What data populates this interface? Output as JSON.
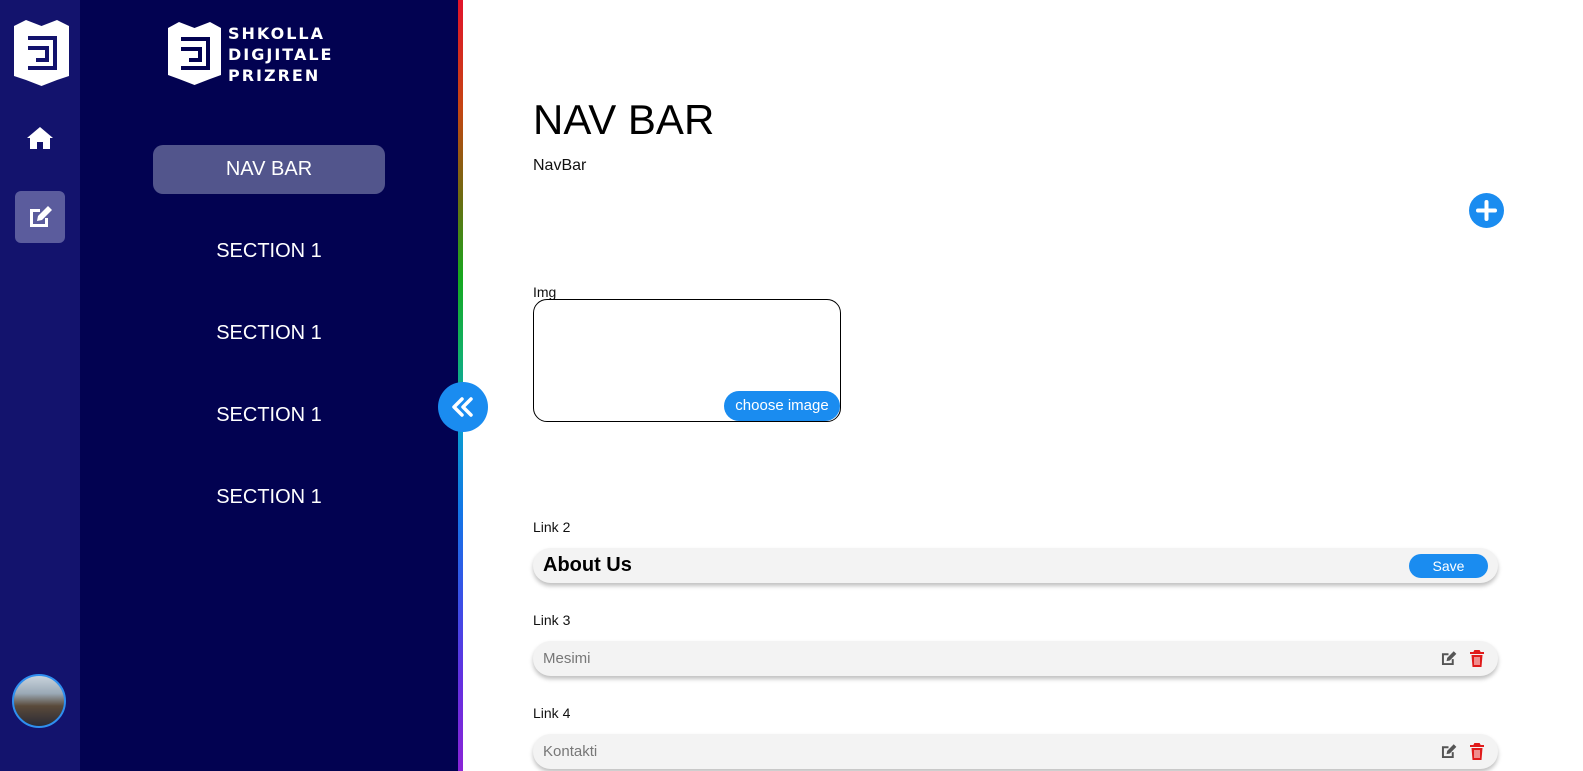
{
  "brand": {
    "line1": "SHKOLLA",
    "line2": "DIGJITALE",
    "line3": "PRIZREN"
  },
  "rail": {
    "icons": [
      "logo-icon",
      "home-icon",
      "edit-icon",
      "avatar"
    ]
  },
  "menu": {
    "items": [
      {
        "label": "NAV BAR",
        "active": true
      },
      {
        "label": "SECTION 1",
        "active": false
      },
      {
        "label": "SECTION 1",
        "active": false
      },
      {
        "label": "SECTION 1",
        "active": false
      },
      {
        "label": "SECTION 1",
        "active": false
      }
    ]
  },
  "main": {
    "title": "NAV BAR",
    "subtitle": "NavBar",
    "img_label": "Img",
    "choose_image": "choose image",
    "links": [
      {
        "label": "Link 2",
        "value": "About Us",
        "action": "Save"
      },
      {
        "label": "Link 3",
        "value": "Mesimi"
      },
      {
        "label": "Link 4",
        "value": "Kontakti"
      }
    ]
  },
  "colors": {
    "rail_bg": "#13136d",
    "panel_bg": "#020251",
    "accent": "#1a8cf0",
    "active_item": "#52558c",
    "delete": "#e01b1b"
  }
}
